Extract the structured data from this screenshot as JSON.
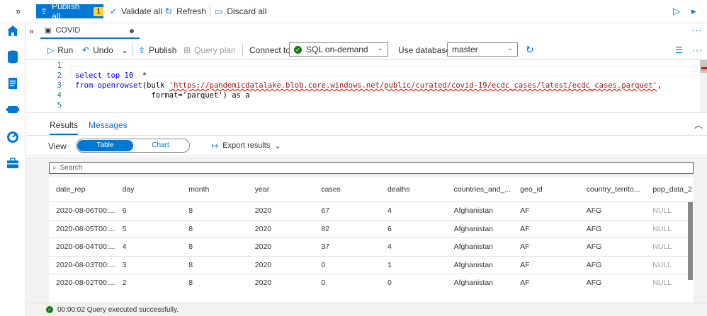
{
  "topbar": {
    "publish_all_label": "Publish all",
    "publish_count": "1",
    "validate_label": "Validate all",
    "refresh_label": "Refresh",
    "discard_label": "Discard all"
  },
  "tab": {
    "title": "COVID"
  },
  "toolbar": {
    "run_label": "Run",
    "undo_label": "Undo",
    "publish_label": "Publish",
    "query_plan_label": "Query plan",
    "connect_to_label": "Connect to",
    "connect_value": "SQL on-demand",
    "use_database_label": "Use database",
    "database_value": "master"
  },
  "editor": {
    "lines": [
      "1",
      "2",
      "3",
      "4",
      "5"
    ],
    "line2_kw": "select top 10",
    "line2_rest": "  *",
    "line3_kw": "from openrowset",
    "line3_a": "(bulk ",
    "line3_url": "'https://pandemicdatalake.blob.core.windows.net/public/curated/covid-19/ecdc_cases/latest/ecdc_cases.parquet'",
    "line3_b": ",",
    "line4_indent": "                 ",
    "line4_text": "format='parquet') as a"
  },
  "results": {
    "tab_results": "Results",
    "tab_messages": "Messages",
    "view_label": "View",
    "toggle_table": "Table",
    "toggle_chart": "Chart",
    "export_label": "Export results",
    "search_placeholder": "Search",
    "columns": [
      "date_rep",
      "day",
      "month",
      "year",
      "cases",
      "deaths",
      "countries_and_...",
      "geo_id",
      "country_territo...",
      "pop_data_2"
    ],
    "rows": [
      [
        "2020-08-06T00:...",
        "6",
        "8",
        "2020",
        "67",
        "4",
        "Afghanistan",
        "AF",
        "AFG",
        "NULL"
      ],
      [
        "2020-08-05T00:...",
        "5",
        "8",
        "2020",
        "82",
        "6",
        "Afghanistan",
        "AF",
        "AFG",
        "NULL"
      ],
      [
        "2020-08-04T00:...",
        "4",
        "8",
        "2020",
        "37",
        "4",
        "Afghanistan",
        "AF",
        "AFG",
        "NULL"
      ],
      [
        "2020-08-03T00:...",
        "3",
        "8",
        "2020",
        "0",
        "1",
        "Afghanistan",
        "AF",
        "AFG",
        "NULL"
      ],
      [
        "2020-08-02T00:...",
        "2",
        "8",
        "2020",
        "0",
        "0",
        "Afghanistan",
        "AF",
        "AFG",
        "NULL"
      ]
    ]
  },
  "status": {
    "text": "00:00:02 Query executed successfully."
  },
  "icons": [
    "home-icon",
    "data-icon",
    "develop-icon",
    "integrate-icon",
    "monitor-icon",
    "manage-icon"
  ],
  "colors": {
    "accent": "#0078d4",
    "success": "#107c10",
    "badge": "#ffd335"
  }
}
